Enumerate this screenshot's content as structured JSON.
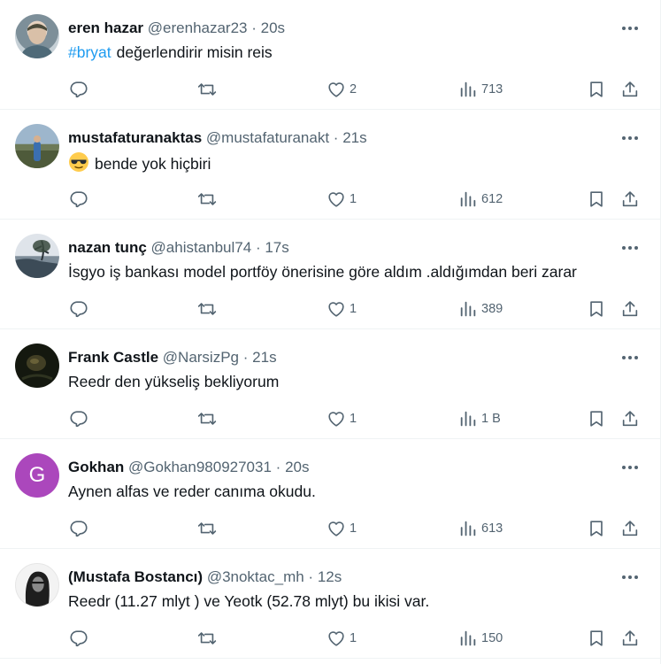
{
  "tweets": [
    {
      "name": "eren hazar",
      "handle": "@erenhazar23",
      "time": "20s",
      "hashtag": "#bryat",
      "text": "değerlendirir misin reis",
      "likes": "2",
      "views": "713",
      "avatar": {
        "type": "photo",
        "colors": [
          "#c9d2d8",
          "#6f8a98"
        ]
      }
    },
    {
      "name": "mustafaturanaktas",
      "handle": "@mustafaturanakt",
      "time": "21s",
      "emoji": "😎",
      "text": "bende yok hiçbiri",
      "likes": "1",
      "views": "612",
      "avatar": {
        "type": "photo",
        "colors": [
          "#9fb7cf",
          "#4a5a3a"
        ]
      }
    },
    {
      "name": "nazan tunç",
      "handle": "@ahistanbul74",
      "time": "17s",
      "text": "İsgyo iş bankası model portföy önerisine göre aldım .aldığımdan beri zarar",
      "likes": "1",
      "views": "389",
      "avatar": {
        "type": "photo",
        "colors": [
          "#d9dfe6",
          "#3d4a55"
        ]
      }
    },
    {
      "name": "Frank Castle",
      "handle": "@NarsizPg",
      "time": "21s",
      "text": "Reedr den yükseliş bekliyorum",
      "likes": "1",
      "views": "1 B",
      "avatar": {
        "type": "photo",
        "colors": [
          "#1a1f14",
          "#5b5a2e"
        ]
      }
    },
    {
      "name": "Gokhan",
      "handle": "@Gokhan980927031",
      "time": "20s",
      "text": "Aynen alfas ve reder canıma okudu.",
      "likes": "1",
      "views": "613",
      "avatar": {
        "type": "letter",
        "letter": "G",
        "color": "#ab47bc"
      }
    },
    {
      "name": "(Mustafa Bostancı)",
      "handle": "@3noktac_mh",
      "time": "12s",
      "text": "Reedr (11.27 mlyt ) ve Yeotk (52.78 mlyt) bu ikisi var.",
      "likes": "1",
      "views": "150",
      "avatar": {
        "type": "photo",
        "colors": [
          "#f2f2f2",
          "#1b1b1b"
        ]
      }
    }
  ],
  "separator": "·",
  "colors": {
    "primary_text": "#0f1419",
    "secondary_text": "#536471",
    "link": "#1d9bf0",
    "border": "#eff3f4"
  }
}
